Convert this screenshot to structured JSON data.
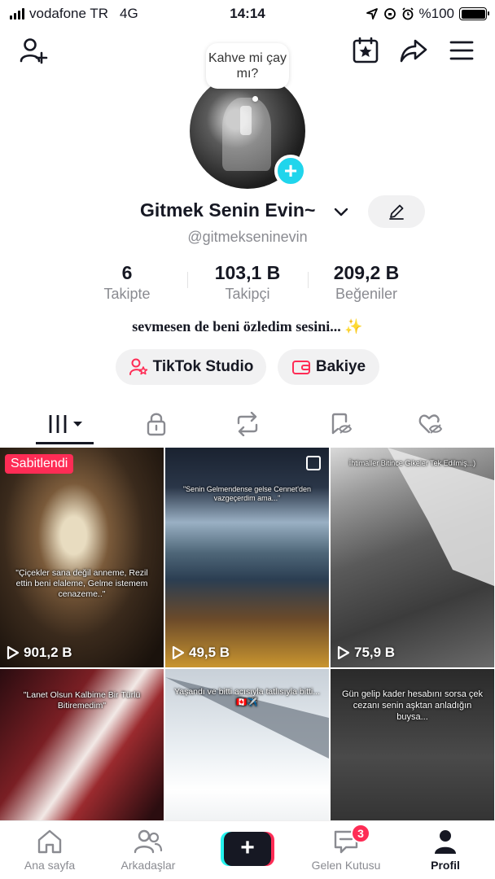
{
  "status_bar": {
    "carrier": "vodafone TR",
    "network": "4G",
    "time": "14:14",
    "battery": "%100"
  },
  "bubble": {
    "text": "Kahve mi çay mı?"
  },
  "profile": {
    "display_name": "Gitmek Senin Evin~",
    "username": "@gitmekseninevin",
    "bio": "sevmesen de beni özledim sesini... ✨"
  },
  "stats": [
    {
      "value": "6",
      "label": "Takipte"
    },
    {
      "value": "103,1 B",
      "label": "Takipçi"
    },
    {
      "value": "209,2 B",
      "label": "Beğeniler"
    }
  ],
  "buttons": {
    "studio": "TikTok Studio",
    "balance": "Bakiye"
  },
  "tabs": [
    "videos-tab",
    "private-tab",
    "reposts-tab",
    "favorites-tab",
    "liked-tab"
  ],
  "videos": [
    {
      "views": "901,2 B",
      "pinned": "Sabitlendi",
      "caption": "\"Çiçekler sana değil anneme, Rezil ettin beni elaleme, Gelme istemem cenazeme..\""
    },
    {
      "views": "49,5 B",
      "caption": "\"Senin Gelmendense gelse Cennet'den vazgeçerdim ama...\""
    },
    {
      "views": "75,9 B",
      "caption": "İhtimaller Bitince Gikeler Tek Edilmiş...)"
    },
    {
      "views": "",
      "caption": "\"Lanet Olsun Kalbime Bir Türlü Bitiremedim\""
    },
    {
      "views": "",
      "caption": "Yaşandı ve bitti acısıyla tatlısıyla bitti... 🇨🇦✈️"
    },
    {
      "views": "",
      "caption": "Gün gelip kader hesabını sorsa çek cezanı senin aşktan anladığın buysa..."
    }
  ],
  "nav": {
    "home": "Ana sayfa",
    "friends": "Arkadaşlar",
    "inbox": "Gelen Kutusu",
    "inbox_badge": "3",
    "profile": "Profil"
  },
  "colors": {
    "accent": "#fe2c55",
    "teal": "#20d5ec",
    "text": "#161823",
    "muted": "#8a8b91"
  }
}
